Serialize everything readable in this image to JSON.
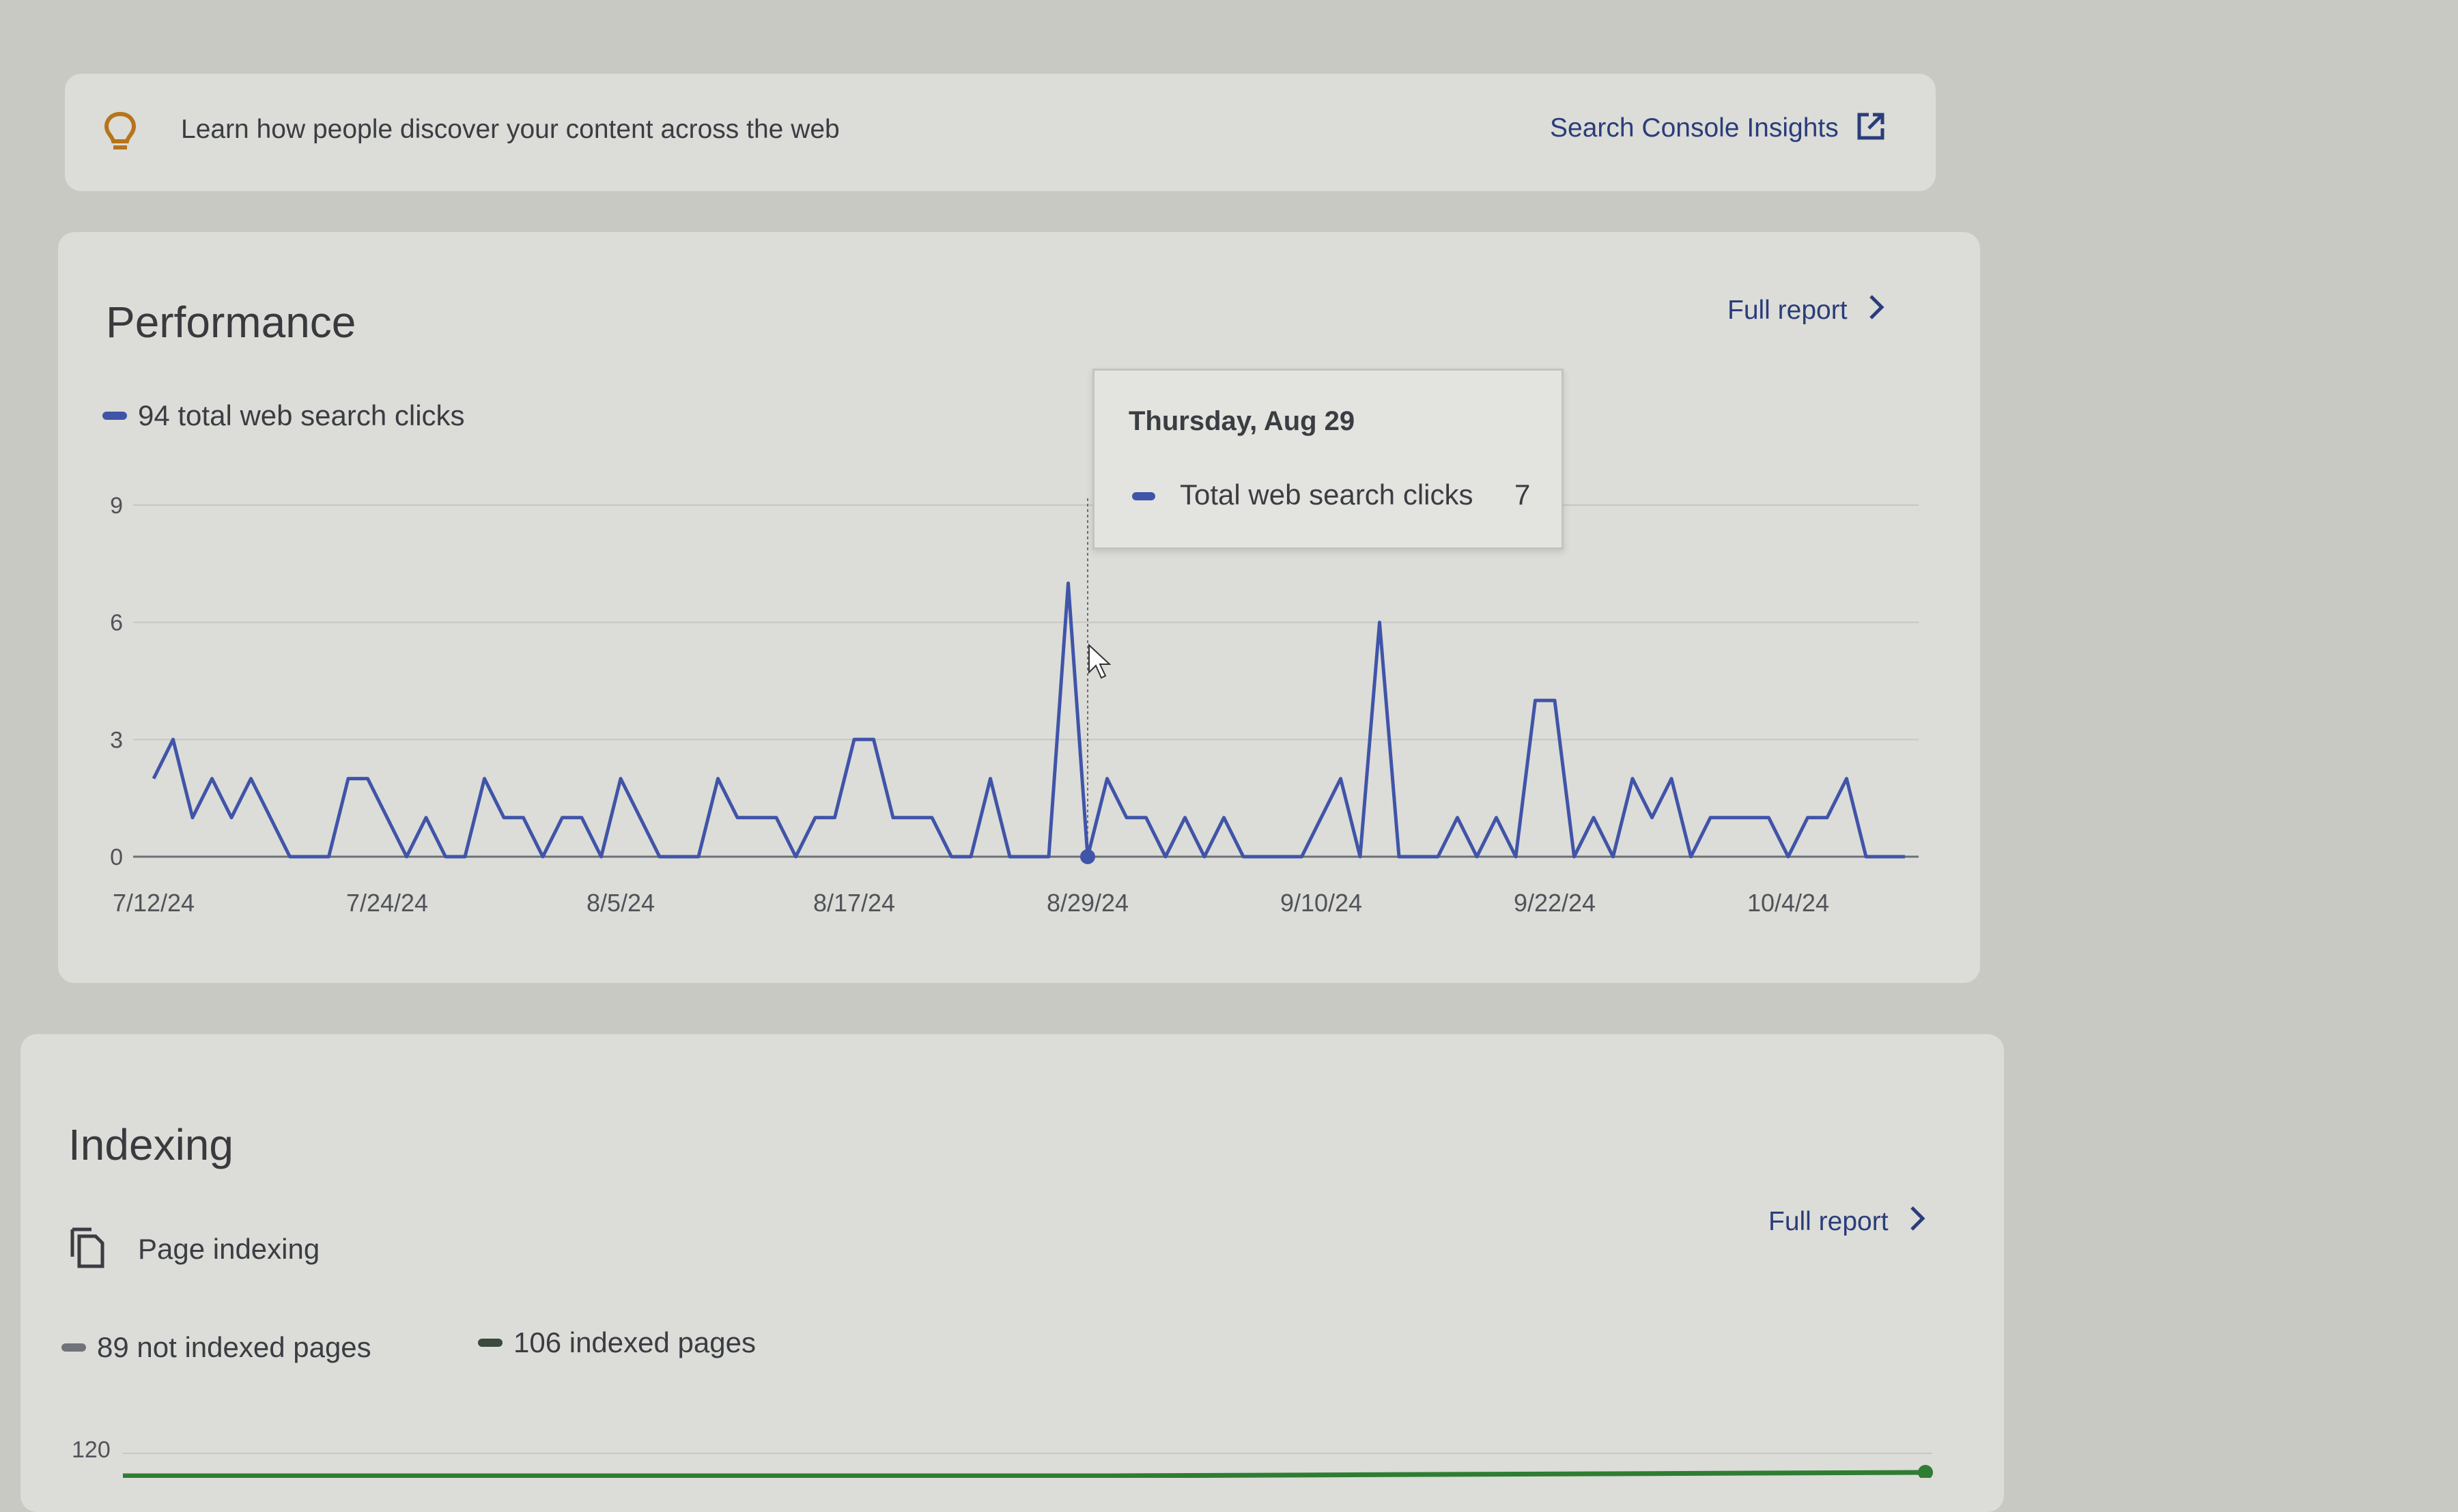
{
  "insights": {
    "text": "Learn how people discover your content across the web",
    "link_label": "Search Console Insights",
    "icon": "lightbulb-icon",
    "link_icon": "open-in-new-icon"
  },
  "performance": {
    "title": "Performance",
    "full_report_label": "Full report",
    "legend_label": "94 total web search clicks",
    "line_color": "#4054a8",
    "tooltip": {
      "date": "Thursday, Aug 29",
      "series_label": "Total web search clicks",
      "value": "7"
    }
  },
  "indexing": {
    "title": "Indexing",
    "subtitle": "Page indexing",
    "full_report_label": "Full report",
    "legend_not_indexed": "89 not indexed pages",
    "legend_indexed": "106 indexed pages",
    "y_top_tick": "120",
    "not_indexed_color": "#70737a",
    "indexed_color": "#2e7d32"
  },
  "chart_data": [
    {
      "type": "line",
      "series": [
        {
          "name": "94 total web search clicks",
          "values": [
            2,
            3,
            1,
            2,
            1,
            2,
            1,
            0,
            0,
            0,
            2,
            2,
            1,
            0,
            1,
            0,
            0,
            2,
            1,
            1,
            0,
            1,
            1,
            0,
            2,
            1,
            0,
            0,
            0,
            2,
            1,
            1,
            1,
            0,
            1,
            1,
            3,
            3,
            1,
            1,
            1,
            0,
            0,
            2,
            0,
            0,
            0,
            7,
            0,
            2,
            1,
            1,
            0,
            1,
            0,
            1,
            0,
            0,
            0,
            0,
            1,
            2,
            0,
            6,
            0,
            0,
            0,
            1,
            0,
            1,
            0,
            4,
            4,
            0,
            1,
            0,
            2,
            1,
            2,
            0,
            1,
            1,
            1,
            1,
            0,
            1,
            1,
            2,
            0,
            0,
            0
          ]
        }
      ],
      "x_start": "7/12/24",
      "x_end": "10/11/24",
      "x_ticks": [
        "7/12/24",
        "7/24/24",
        "8/5/24",
        "8/17/24",
        "8/29/24",
        "9/10/24",
        "9/22/24",
        "10/4/24"
      ],
      "y_ticks": [
        "0",
        "3",
        "6",
        "9"
      ],
      "ylim": [
        0,
        9
      ],
      "grid": true,
      "legend_placement": "top-left",
      "highlight": {
        "x": "8/29/24",
        "value": 7
      }
    }
  ]
}
